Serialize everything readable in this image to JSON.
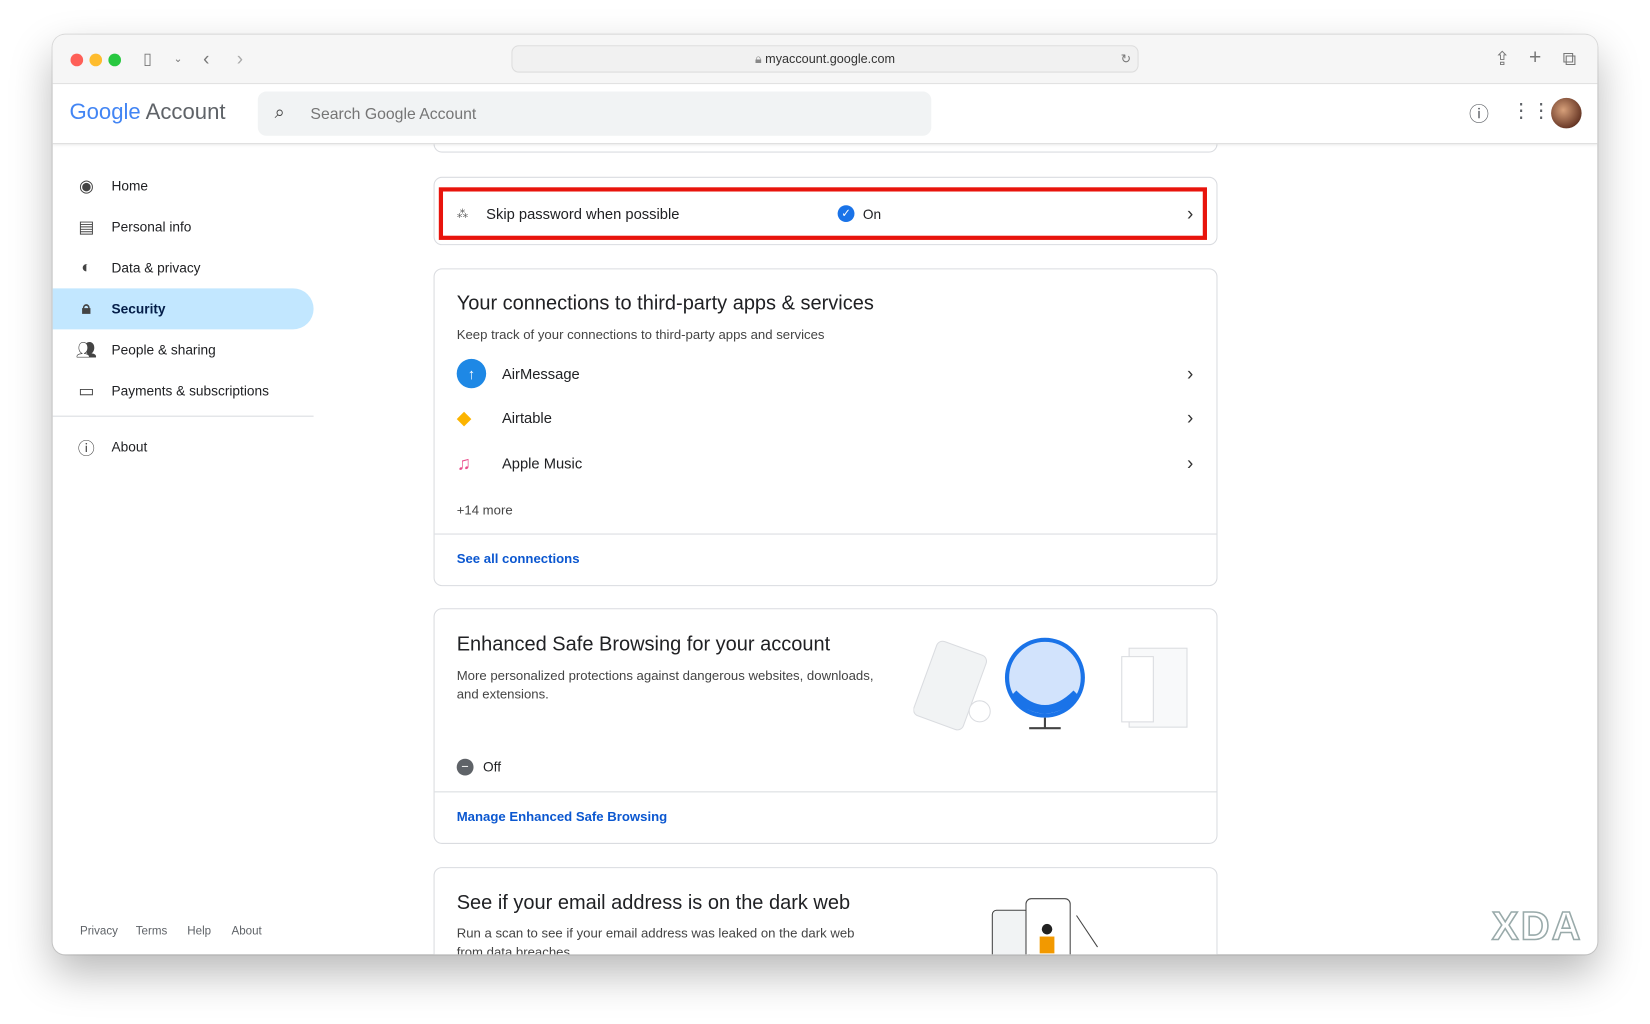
{
  "browser": {
    "url": "myaccount.google.com"
  },
  "header": {
    "logo_google": "Google",
    "logo_account": "Account",
    "search_placeholder": "Search Google Account"
  },
  "sidebar": {
    "items": [
      {
        "label": "Home"
      },
      {
        "label": "Personal info"
      },
      {
        "label": "Data & privacy"
      },
      {
        "label": "Security"
      },
      {
        "label": "People & sharing"
      },
      {
        "label": "Payments & subscriptions"
      }
    ],
    "about": "About",
    "footer": [
      "Privacy",
      "Terms",
      "Help",
      "About"
    ]
  },
  "skip": {
    "label": "Skip password when possible",
    "status": "On"
  },
  "connections": {
    "title": "Your connections to third-party apps & services",
    "subtitle": "Keep track of your connections to third-party apps and services",
    "apps": [
      {
        "name": "AirMessage"
      },
      {
        "name": "Airtable"
      },
      {
        "name": "Apple Music"
      }
    ],
    "more": "+14 more",
    "link": "See all connections"
  },
  "safe_browsing": {
    "title": "Enhanced Safe Browsing for your account",
    "subtitle": "More personalized protections against dangerous websites, downloads, and extensions.",
    "status": "Off",
    "link": "Manage Enhanced Safe Browsing"
  },
  "dark_web": {
    "title": "See if your email address is on the dark web",
    "subtitle": "Run a scan to see if your email address was leaked on the dark web from data breaches"
  },
  "watermark": "XDA",
  "colors": {
    "accent": "#0b57d0",
    "active_nav": "#c2e7ff",
    "highlight": "#e8140c"
  }
}
